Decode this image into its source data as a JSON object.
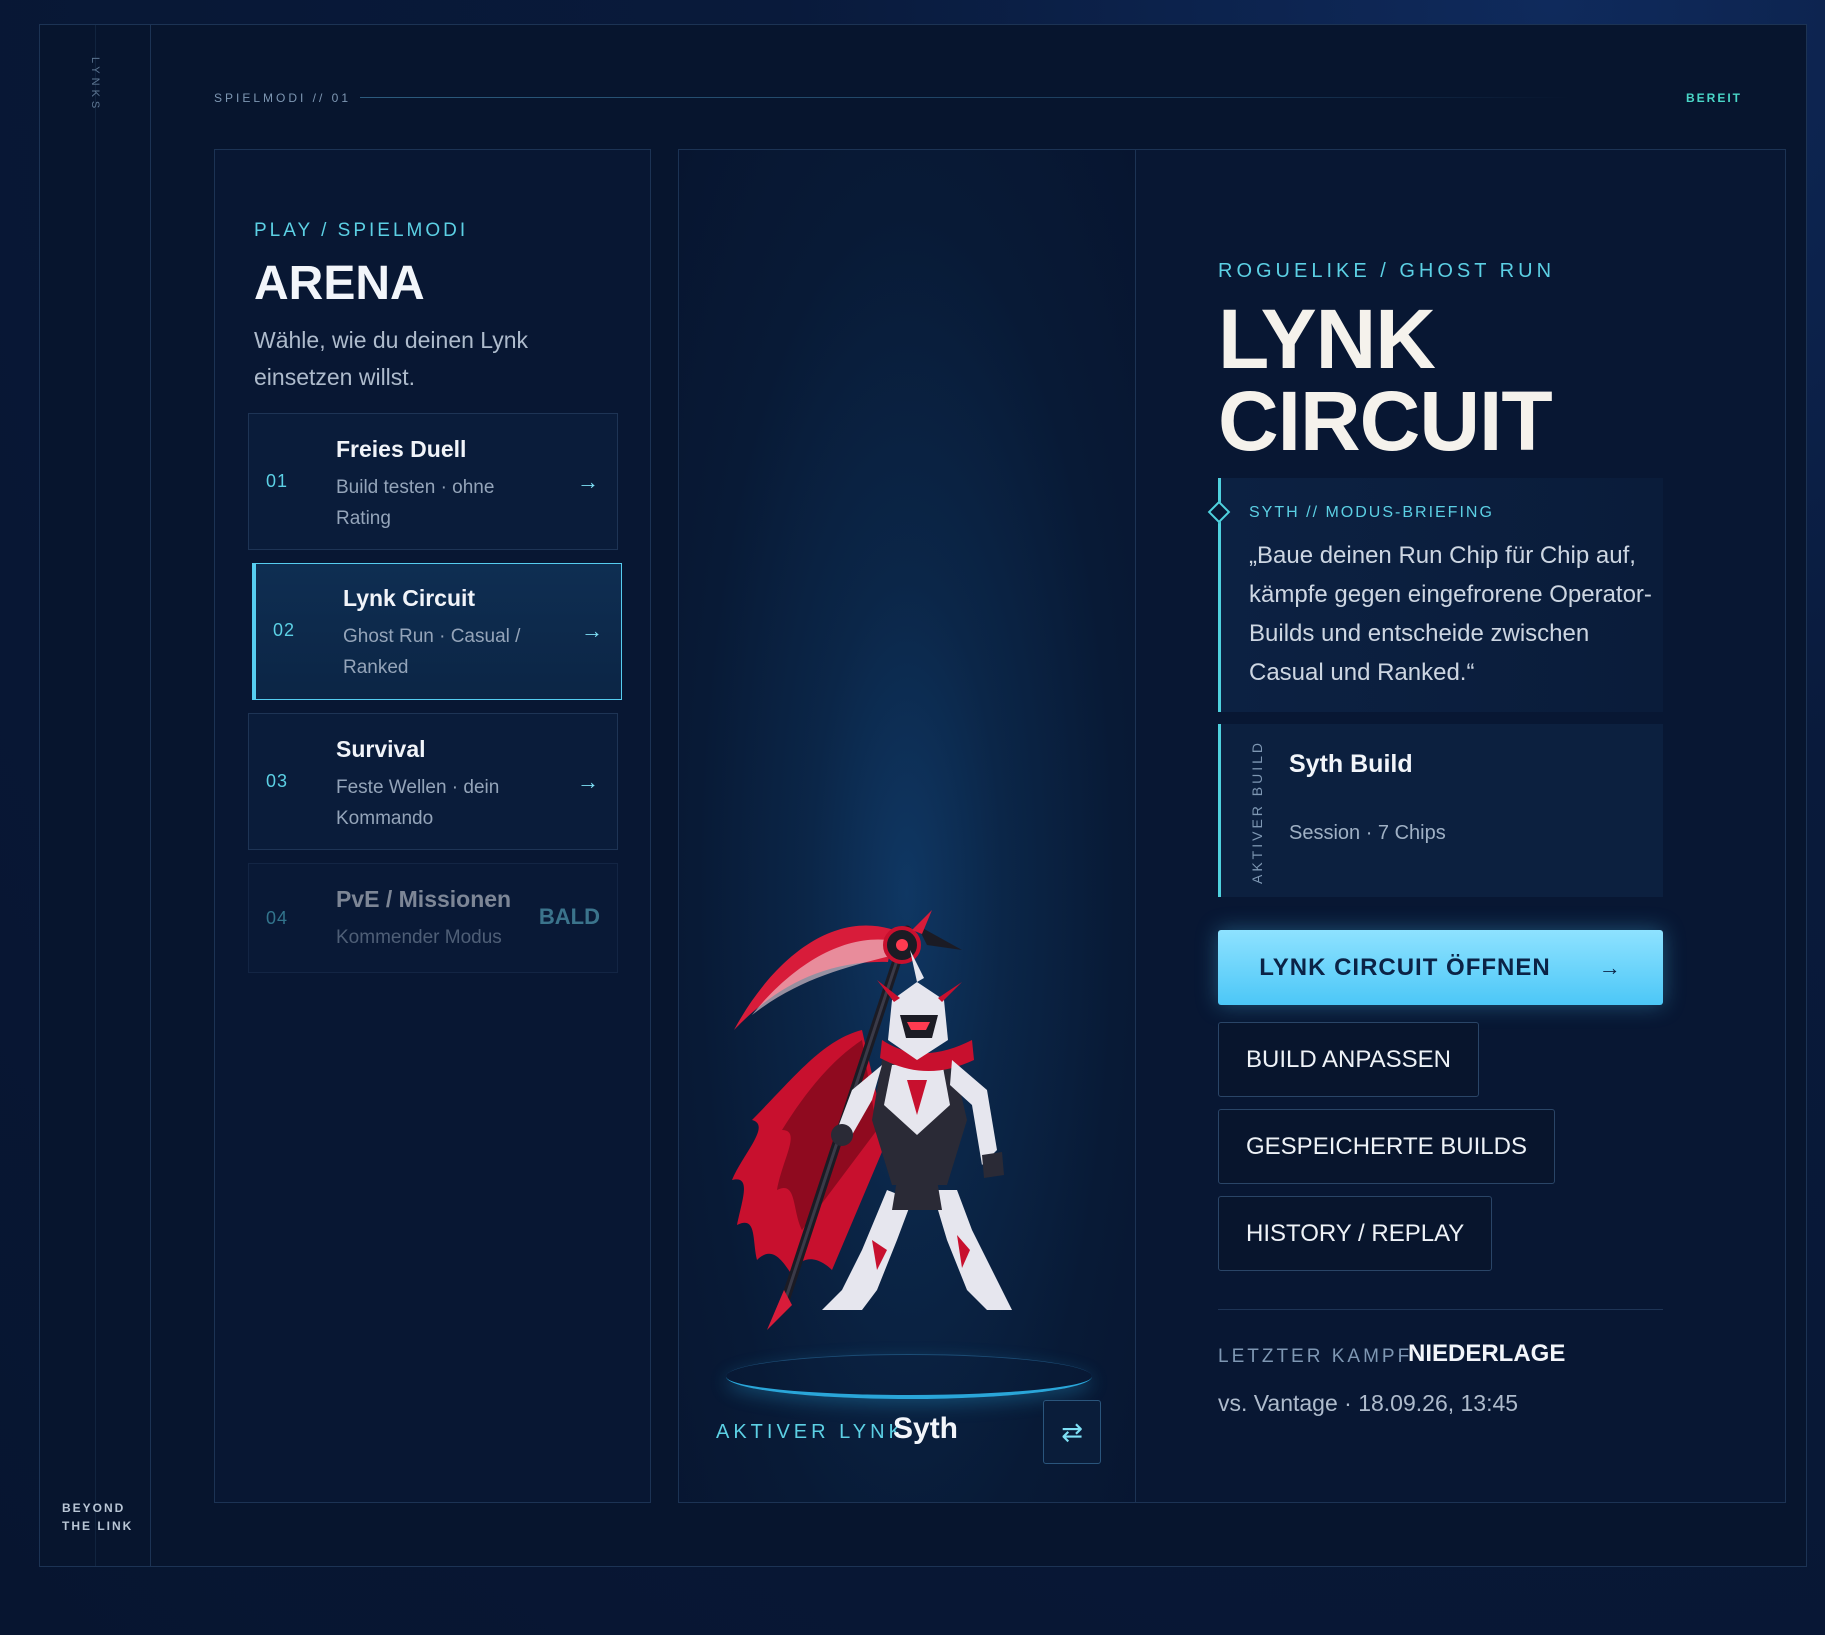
{
  "rail": {
    "top_label": "LYNKS",
    "bottom_line1": "BEYOND",
    "bottom_line2": "THE LINK"
  },
  "topbar": {
    "label": "SPIELMODI // 01",
    "status": "BEREIT"
  },
  "left": {
    "eyebrow": "PLAY / SPIELMODI",
    "title": "ARENA",
    "subtitle": "Wähle, wie du deinen Lynk einsetzen willst.",
    "modes": [
      {
        "num": "01",
        "title": "Freies Duell",
        "sub": "Build testen · ohne Rating",
        "arrow": "→"
      },
      {
        "num": "02",
        "title": "Lynk Circuit",
        "sub": "Ghost Run · Casual / Ranked",
        "arrow": "→",
        "active": true
      },
      {
        "num": "03",
        "title": "Survival",
        "sub": "Feste Wellen · dein Kommando",
        "arrow": "→"
      },
      {
        "num": "04",
        "title": "PvE / Missionen",
        "sub": "Kommender Modus",
        "badge": "BALD",
        "disabled": true
      }
    ]
  },
  "stage": {
    "active_label": "AKTIVER LYNK",
    "active_name": "Syth",
    "swap_icon": "⇄"
  },
  "info": {
    "eyebrow": "ROGUELIKE / GHOST RUN",
    "title_line1": "LYNK",
    "title_line2": "CIRCUIT",
    "briefing_label": "SYTH // MODUS-BRIEFING",
    "briefing_text": "„Baue deinen Run Chip für Chip auf, kämpfe gegen eingefrorene Operator-Builds und entscheide zwischen Casual und Ranked.“",
    "build_vertical": "AKTIVER BUILD",
    "build_title": "Syth Build",
    "build_sub": "Session · 7 Chips",
    "primary_button": "LYNK CIRCUIT ÖFFNEN",
    "primary_arrow": "→",
    "buttons": [
      "BUILD ANPASSEN",
      "GESPEICHERTE BUILDS",
      "HISTORY / REPLAY"
    ],
    "last_label": "LETZTER KAMPF",
    "last_result": "NIEDERLAGE",
    "last_detail": "vs. Vantage · 18.09.26, 13:45"
  },
  "colors": {
    "accent": "#5cd0e4",
    "primary": "#4cc7f7",
    "background": "#07152e",
    "character_red": "#c8102e"
  }
}
